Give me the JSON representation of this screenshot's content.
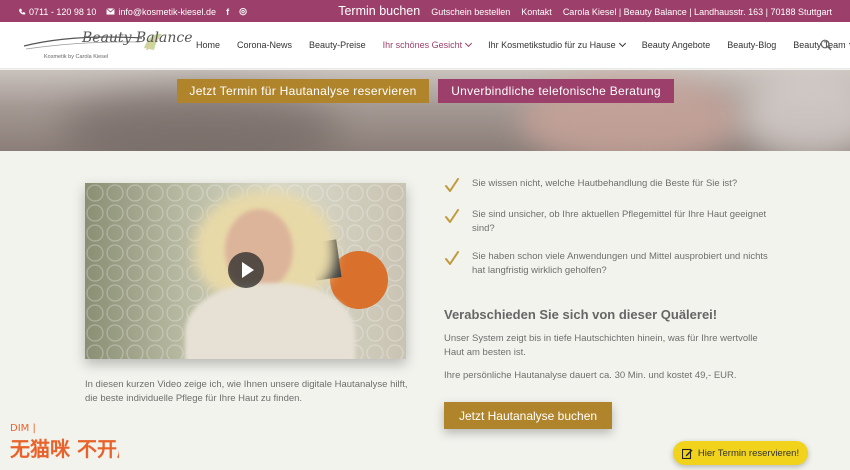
{
  "topbar": {
    "phone": "0711 - 120 98 10",
    "email": "info@kosmetik-kiesel.de",
    "social_icons": [
      "facebook-icon",
      "instagram-icon"
    ],
    "facebook_glyph": "f",
    "instagram_glyph": "◎",
    "links": {
      "termin": "Termin buchen",
      "gutschein": "Gutschein bestellen",
      "kontakt": "Kontakt",
      "address": "Carola Kiesel | Beauty Balance | Landhausstr. 163 | 70188 Stuttgart"
    }
  },
  "logo": {
    "wordmark": "Beauty Balance",
    "tagline": "Kosmetik by Carola Kiesel"
  },
  "nav": {
    "items": [
      {
        "label": "Home",
        "dropdown": false,
        "active": false
      },
      {
        "label": "Corona-News",
        "dropdown": false,
        "active": false
      },
      {
        "label": "Beauty-Preise",
        "dropdown": false,
        "active": false
      },
      {
        "label": "Ihr schönes Gesicht",
        "dropdown": true,
        "active": true
      },
      {
        "label": "Ihr Kosmetikstudio für zu Hause",
        "dropdown": true,
        "active": false
      },
      {
        "label": "Beauty Angebote",
        "dropdown": false,
        "active": false
      },
      {
        "label": "Beauty-Blog",
        "dropdown": false,
        "active": false
      },
      {
        "label": "Beauty Team",
        "dropdown": true,
        "active": false
      }
    ]
  },
  "hero": {
    "btn_termin": "Jetzt Termin für Hautanalyse reservieren",
    "btn_beratung": "Unverbindliche telefonische Beratung"
  },
  "video": {
    "caption": "In diesen kurzen Video zeige ich, wie Ihnen unsere digitale Hautanalyse hilft, die beste individuelle Pflege für Ihre Haut zu finden."
  },
  "checks": [
    "Sie wissen nicht, welche Hautbehandlung die Beste für Sie ist?",
    "Sie sind unsicher, ob Ihre aktuellen Pflegemittel für Ihre Haut geeignet sind?",
    "Sie haben schon viele Anwendungen und Mittel ausprobiert und nichts hat langfristig wirklich geholfen?"
  ],
  "main": {
    "heading": "Verabschieden Sie sich von dieser Quälerei!",
    "para1": "Unser System zeigt bis in tiefe Hautschichten hinein, was für Ihre wertvolle Haut am besten ist.",
    "para2": "Ihre persönliche Hautanalyse dauert ca. 30 Min. und kostet 49,- EUR.",
    "book_button": "Jetzt Hautanalyse buchen"
  },
  "floating": {
    "label": "Hier Termin reservieren!"
  },
  "watermark": {
    "top": "DIM | ",
    "main": "无猫咪 不开店"
  },
  "colors": {
    "brand_plum": "#9c3f6a",
    "brand_gold": "#b0842b",
    "float_yellow": "#f0d31a",
    "page_bg": "#f3f3ee"
  }
}
